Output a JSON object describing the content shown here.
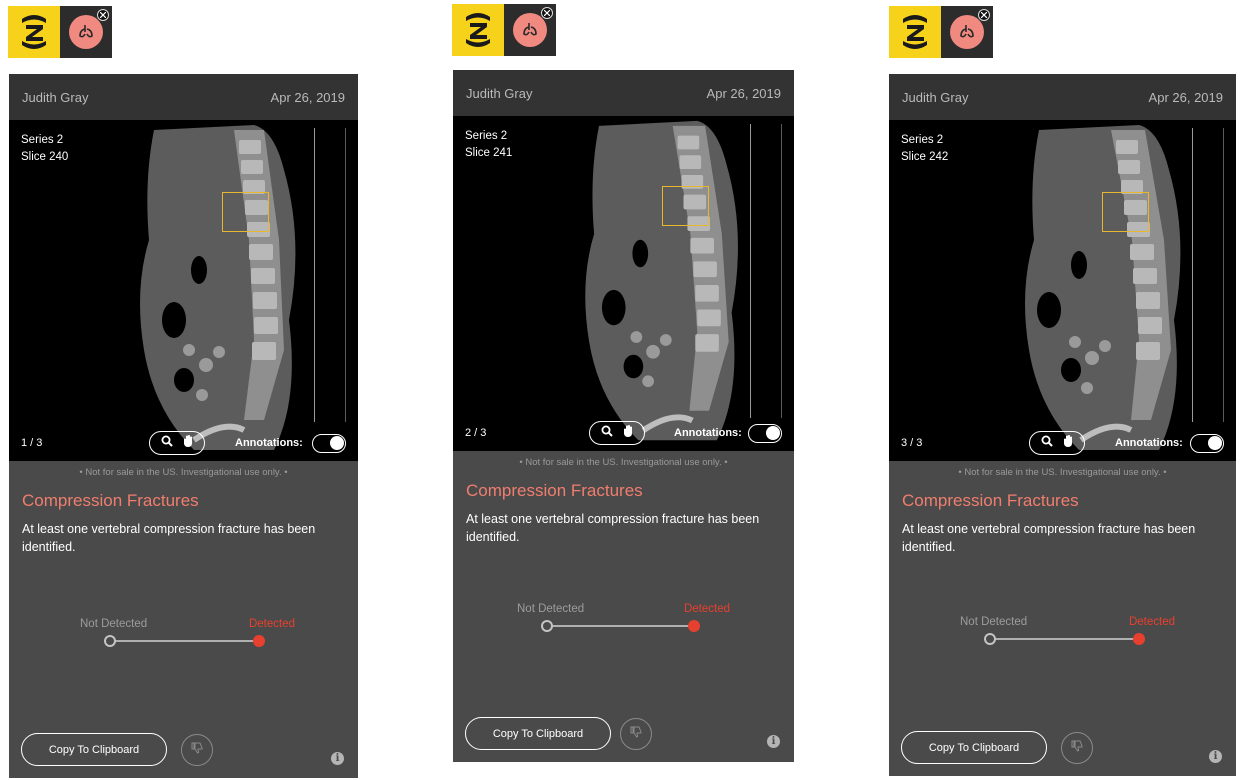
{
  "panels": [
    {
      "patient_name": "Judith Gray",
      "study_date": "Apr 26, 2019",
      "series_label": "Series 2",
      "slice_label": "Slice 240",
      "page_counter": "1 / 3",
      "annotations_label": "Annotations:",
      "disclaimer": "• Not for sale in the US. Investigational use only. •",
      "finding_title": "Compression Fractures",
      "finding_description": "At least one vertebral compression fracture has been identified.",
      "not_detected_label": "Not Detected",
      "detected_label": "Detected",
      "copy_button_label": "Copy To Clipboard"
    },
    {
      "patient_name": "Judith Gray",
      "study_date": "Apr 26, 2019",
      "series_label": "Series 2",
      "slice_label": "Slice 241",
      "page_counter": "2 / 3",
      "annotations_label": "Annotations:",
      "disclaimer": "• Not for sale in the US. Investigational use only. •",
      "finding_title": "Compression Fractures",
      "finding_description": "At least one vertebral compression fracture has been identified.",
      "not_detected_label": "Not Detected",
      "detected_label": "Detected",
      "copy_button_label": "Copy To Clipboard"
    },
    {
      "patient_name": "Judith Gray",
      "study_date": "Apr 26, 2019",
      "series_label": "Series 2",
      "slice_label": "Slice 242",
      "page_counter": "3 / 3",
      "annotations_label": "Annotations:",
      "disclaimer": "• Not for sale in the US. Investigational use only. •",
      "finding_title": "Compression Fractures",
      "finding_description": "At least one vertebral compression fracture has been identified.",
      "not_detected_label": "Not Detected",
      "detected_label": "Detected",
      "copy_button_label": "Copy To Clipboard"
    }
  ],
  "icons": {
    "logo": "zebra-logo-icon",
    "ai_badge": "lungs-icon",
    "close": "close-icon",
    "zoom": "magnifier-icon",
    "pan": "hand-icon",
    "feedback": "thumbs-down-icon",
    "info": "info-icon"
  },
  "colors": {
    "logo_yellow": "#f6d21a",
    "finding_title": "#f07e6e",
    "detected_red": "#e8402e",
    "roi_box": "#e8b82a",
    "panel_bg": "#4a4a4a",
    "header_bg": "#333333"
  }
}
